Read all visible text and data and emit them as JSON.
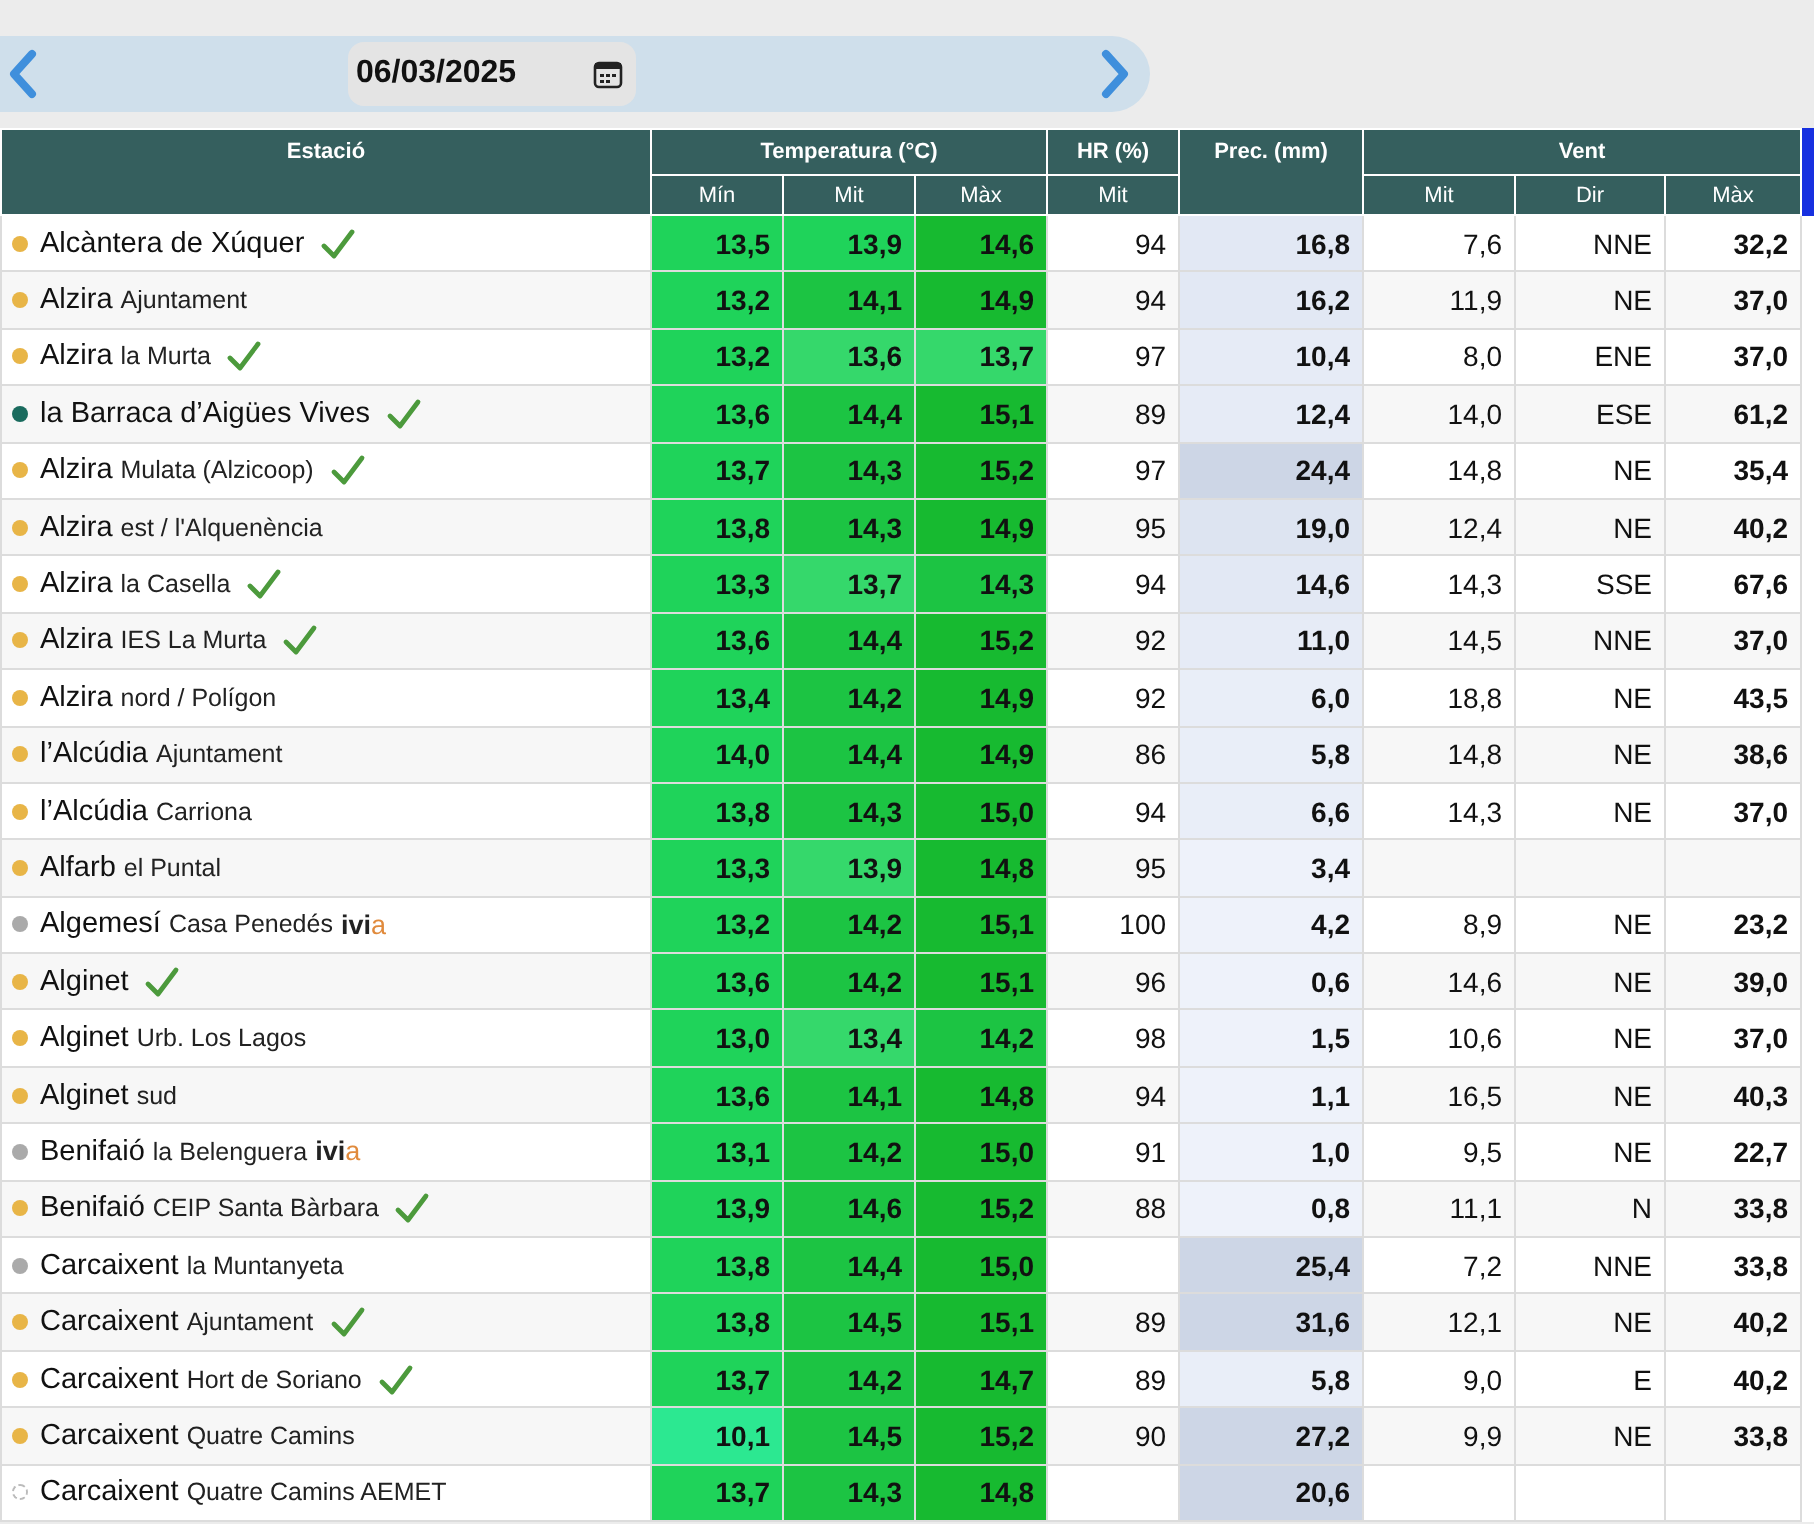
{
  "date_bar": {
    "date": "06/03/2025"
  },
  "table": {
    "groups": [
      {
        "label": "Estació"
      },
      {
        "label": "Temperatura (°C)",
        "subcolumns": [
          "Mín",
          "Mit",
          "Màx"
        ]
      },
      {
        "label": "HR (%)",
        "subcolumns": [
          "Mit"
        ]
      },
      {
        "label": "Prec. (mm)"
      },
      {
        "label": "Vent",
        "subcolumns": [
          "Mit",
          "Dir",
          "Màx"
        ]
      }
    ],
    "rows": [
      {
        "kind": "filled",
        "color": "#e8b547",
        "town": "Alcàntera de Xúquer",
        "place": null,
        "checked": true,
        "tag": null,
        "temps": [
          {
            "v": "13,5",
            "color": "#1fd35a"
          },
          {
            "v": "13,9",
            "color": "#1fd35a"
          },
          {
            "v": "14,6",
            "color": "#17ba30"
          }
        ],
        "hr": "94",
        "prec": {
          "v": "16,8",
          "color": "#e2e8f4"
        },
        "wind": "7,6",
        "dir": "NNE",
        "gust": "32,2"
      },
      {
        "kind": "filled",
        "color": "#e8b547",
        "town": "Alzira",
        "place": "Ajuntament",
        "checked": false,
        "tag": null,
        "temps": [
          {
            "v": "13,2",
            "color": "#1fd35a"
          },
          {
            "v": "14,1",
            "color": "#1cc443"
          },
          {
            "v": "14,9",
            "color": "#17ba30"
          }
        ],
        "hr": "94",
        "prec": {
          "v": "16,2",
          "color": "#e2e8f4"
        },
        "wind": "11,9",
        "dir": "NE",
        "gust": "37,0"
      },
      {
        "kind": "filled",
        "color": "#e8b547",
        "town": "Alzira",
        "place": "la Murta",
        "checked": true,
        "tag": null,
        "temps": [
          {
            "v": "13,2",
            "color": "#1fd35a"
          },
          {
            "v": "13,6",
            "color": "#35d86b"
          },
          {
            "v": "13,7",
            "color": "#35d86b"
          }
        ],
        "hr": "97",
        "prec": {
          "v": "10,4",
          "color": "#e6ebf6"
        },
        "wind": "8,0",
        "dir": "ENE",
        "gust": "37,0"
      },
      {
        "kind": "filled",
        "color": "#1a6b5e",
        "town": "la Barraca d’Aigües Vives",
        "place": null,
        "checked": true,
        "tag": null,
        "temps": [
          {
            "v": "13,6",
            "color": "#1fd35a"
          },
          {
            "v": "14,4",
            "color": "#1cc443"
          },
          {
            "v": "15,1",
            "color": "#17ba30"
          }
        ],
        "hr": "89",
        "prec": {
          "v": "12,4",
          "color": "#e6ebf6"
        },
        "wind": "14,0",
        "dir": "ESE",
        "gust": "61,2"
      },
      {
        "kind": "filled",
        "color": "#e8b547",
        "town": "Alzira",
        "place": "Mulata (Alzicoop)",
        "checked": true,
        "tag": null,
        "temps": [
          {
            "v": "13,7",
            "color": "#1fd35a"
          },
          {
            "v": "14,3",
            "color": "#1cc443"
          },
          {
            "v": "15,2",
            "color": "#17ba30"
          }
        ],
        "hr": "97",
        "prec": {
          "v": "24,4",
          "color": "#cdd6e6"
        },
        "wind": "14,8",
        "dir": "NE",
        "gust": "35,4"
      },
      {
        "kind": "filled",
        "color": "#e8b547",
        "town": "Alzira",
        "place": "est / l'Alquenència",
        "checked": false,
        "tag": null,
        "temps": [
          {
            "v": "13,8",
            "color": "#1fd35a"
          },
          {
            "v": "14,3",
            "color": "#1cc443"
          },
          {
            "v": "14,9",
            "color": "#17ba30"
          }
        ],
        "hr": "95",
        "prec": {
          "v": "19,0",
          "color": "#dde4f1"
        },
        "wind": "12,4",
        "dir": "NE",
        "gust": "40,2"
      },
      {
        "kind": "filled",
        "color": "#e8b547",
        "town": "Alzira",
        "place": "la Casella",
        "checked": true,
        "tag": null,
        "temps": [
          {
            "v": "13,3",
            "color": "#1fd35a"
          },
          {
            "v": "13,7",
            "color": "#35d86b"
          },
          {
            "v": "14,3",
            "color": "#1cc443"
          }
        ],
        "hr": "94",
        "prec": {
          "v": "14,6",
          "color": "#e2e8f4"
        },
        "wind": "14,3",
        "dir": "SSE",
        "gust": "67,6"
      },
      {
        "kind": "filled",
        "color": "#e8b547",
        "town": "Alzira",
        "place": "IES La Murta",
        "checked": true,
        "tag": null,
        "temps": [
          {
            "v": "13,6",
            "color": "#1fd35a"
          },
          {
            "v": "14,4",
            "color": "#1cc443"
          },
          {
            "v": "15,2",
            "color": "#17ba30"
          }
        ],
        "hr": "92",
        "prec": {
          "v": "11,0",
          "color": "#e6ebf6"
        },
        "wind": "14,5",
        "dir": "NNE",
        "gust": "37,0"
      },
      {
        "kind": "filled",
        "color": "#e8b547",
        "town": "Alzira",
        "place": "nord / Polígon",
        "checked": false,
        "tag": null,
        "temps": [
          {
            "v": "13,4",
            "color": "#1fd35a"
          },
          {
            "v": "14,2",
            "color": "#1cc443"
          },
          {
            "v": "14,9",
            "color": "#17ba30"
          }
        ],
        "hr": "92",
        "prec": {
          "v": "6,0",
          "color": "#e9eef8"
        },
        "wind": "18,8",
        "dir": "NE",
        "gust": "43,5"
      },
      {
        "kind": "filled",
        "color": "#e8b547",
        "town": "l’Alcúdia",
        "place": "Ajuntament",
        "checked": false,
        "tag": null,
        "temps": [
          {
            "v": "14,0",
            "color": "#1fd35a"
          },
          {
            "v": "14,4",
            "color": "#1cc443"
          },
          {
            "v": "14,9",
            "color": "#17ba30"
          }
        ],
        "hr": "86",
        "prec": {
          "v": "5,8",
          "color": "#e9eef8"
        },
        "wind": "14,8",
        "dir": "NE",
        "gust": "38,6"
      },
      {
        "kind": "filled",
        "color": "#e8b547",
        "town": "l’Alcúdia",
        "place": "Carriona",
        "checked": false,
        "tag": null,
        "temps": [
          {
            "v": "13,8",
            "color": "#1fd35a"
          },
          {
            "v": "14,3",
            "color": "#1cc443"
          },
          {
            "v": "15,0",
            "color": "#17ba30"
          }
        ],
        "hr": "94",
        "prec": {
          "v": "6,6",
          "color": "#e9eef8"
        },
        "wind": "14,3",
        "dir": "NE",
        "gust": "37,0"
      },
      {
        "kind": "filled",
        "color": "#e8b547",
        "town": "Alfarb",
        "place": "el Puntal",
        "checked": false,
        "tag": null,
        "temps": [
          {
            "v": "13,3",
            "color": "#1fd35a"
          },
          {
            "v": "13,9",
            "color": "#35d86b"
          },
          {
            "v": "14,8",
            "color": "#17ba30"
          }
        ],
        "hr": "95",
        "prec": {
          "v": "3,4",
          "color": "#eef2fa"
        },
        "wind": null,
        "dir": null,
        "gust": null
      },
      {
        "kind": "filled",
        "color": "#aaaaaa",
        "town": "Algemesí",
        "place": "Casa Penedés",
        "checked": false,
        "tag": {
          "main": "ivi",
          "accent": "a"
        },
        "temps": [
          {
            "v": "13,2",
            "color": "#1fd35a"
          },
          {
            "v": "14,2",
            "color": "#1cc443"
          },
          {
            "v": "15,1",
            "color": "#17ba30"
          }
        ],
        "hr": "100",
        "prec": {
          "v": "4,2",
          "color": "#eef2fa"
        },
        "wind": "8,9",
        "dir": "NE",
        "gust": "23,2"
      },
      {
        "kind": "filled",
        "color": "#e8b547",
        "town": "Alginet",
        "place": null,
        "checked": true,
        "tag": null,
        "temps": [
          {
            "v": "13,6",
            "color": "#1fd35a"
          },
          {
            "v": "14,2",
            "color": "#1cc443"
          },
          {
            "v": "15,1",
            "color": "#17ba30"
          }
        ],
        "hr": "96",
        "prec": {
          "v": "0,6",
          "color": "#eef2fa"
        },
        "wind": "14,6",
        "dir": "NE",
        "gust": "39,0"
      },
      {
        "kind": "filled",
        "color": "#e8b547",
        "town": "Alginet",
        "place": "Urb. Los Lagos",
        "checked": false,
        "tag": null,
        "temps": [
          {
            "v": "13,0",
            "color": "#1fd35a"
          },
          {
            "v": "13,4",
            "color": "#35d86b"
          },
          {
            "v": "14,2",
            "color": "#1cc443"
          }
        ],
        "hr": "98",
        "prec": {
          "v": "1,5",
          "color": "#eef2fa"
        },
        "wind": "10,6",
        "dir": "NE",
        "gust": "37,0"
      },
      {
        "kind": "filled",
        "color": "#e8b547",
        "town": "Alginet",
        "place": "sud",
        "checked": false,
        "tag": null,
        "temps": [
          {
            "v": "13,6",
            "color": "#1fd35a"
          },
          {
            "v": "14,1",
            "color": "#1cc443"
          },
          {
            "v": "14,8",
            "color": "#17ba30"
          }
        ],
        "hr": "94",
        "prec": {
          "v": "1,1",
          "color": "#eef2fa"
        },
        "wind": "16,5",
        "dir": "NE",
        "gust": "40,3"
      },
      {
        "kind": "filled",
        "color": "#aaaaaa",
        "town": "Benifaió",
        "place": "la Belenguera",
        "checked": false,
        "tag": {
          "main": "ivi",
          "accent": "a"
        },
        "temps": [
          {
            "v": "13,1",
            "color": "#1fd35a"
          },
          {
            "v": "14,2",
            "color": "#1cc443"
          },
          {
            "v": "15,0",
            "color": "#17ba30"
          }
        ],
        "hr": "91",
        "prec": {
          "v": "1,0",
          "color": "#eef2fa"
        },
        "wind": "9,5",
        "dir": "NE",
        "gust": "22,7"
      },
      {
        "kind": "filled",
        "color": "#e8b547",
        "town": "Benifaió",
        "place": "CEIP Santa Bàrbara",
        "checked": true,
        "tag": null,
        "temps": [
          {
            "v": "13,9",
            "color": "#1fd35a"
          },
          {
            "v": "14,6",
            "color": "#1cc443"
          },
          {
            "v": "15,2",
            "color": "#17ba30"
          }
        ],
        "hr": "88",
        "prec": {
          "v": "0,8",
          "color": "#eef2fa"
        },
        "wind": "11,1",
        "dir": "N",
        "gust": "33,8"
      },
      {
        "kind": "filled",
        "color": "#aaaaaa",
        "town": "Carcaixent",
        "place": "la Muntanyeta",
        "checked": false,
        "tag": null,
        "temps": [
          {
            "v": "13,8",
            "color": "#1fd35a"
          },
          {
            "v": "14,4",
            "color": "#1cc443"
          },
          {
            "v": "15,0",
            "color": "#17ba30"
          }
        ],
        "hr": null,
        "prec": {
          "v": "25,4",
          "color": "#cdd6e6"
        },
        "wind": "7,2",
        "dir": "NNE",
        "gust": "33,8"
      },
      {
        "kind": "filled",
        "color": "#e8b547",
        "town": "Carcaixent",
        "place": "Ajuntament",
        "checked": true,
        "tag": null,
        "temps": [
          {
            "v": "13,8",
            "color": "#1fd35a"
          },
          {
            "v": "14,5",
            "color": "#1cc443"
          },
          {
            "v": "15,1",
            "color": "#17ba30"
          }
        ],
        "hr": "89",
        "prec": {
          "v": "31,6",
          "color": "#cdd6e6"
        },
        "wind": "12,1",
        "dir": "NE",
        "gust": "40,2"
      },
      {
        "kind": "filled",
        "color": "#e8b547",
        "town": "Carcaixent",
        "place": "Hort de Soriano",
        "checked": true,
        "tag": null,
        "temps": [
          {
            "v": "13,7",
            "color": "#1fd35a"
          },
          {
            "v": "14,2",
            "color": "#1cc443"
          },
          {
            "v": "14,7",
            "color": "#17ba30"
          }
        ],
        "hr": "89",
        "prec": {
          "v": "5,8",
          "color": "#e9eef8"
        },
        "wind": "9,0",
        "dir": "E",
        "gust": "40,2"
      },
      {
        "kind": "filled",
        "color": "#e8b547",
        "town": "Carcaixent",
        "place": "Quatre Camins",
        "checked": false,
        "tag": null,
        "temps": [
          {
            "v": "10,1",
            "color": "#2ce891"
          },
          {
            "v": "14,5",
            "color": "#1cc443"
          },
          {
            "v": "15,2",
            "color": "#17ba30"
          }
        ],
        "hr": "90",
        "prec": {
          "v": "27,2",
          "color": "#cdd6e6"
        },
        "wind": "9,9",
        "dir": "NE",
        "gust": "33,8"
      },
      {
        "kind": "outline",
        "color": "#bbbbbb",
        "town": "Carcaixent",
        "place": "Quatre Camins AEMET",
        "checked": false,
        "tag": null,
        "temps": [
          {
            "v": "13,7",
            "color": "#1fd35a"
          },
          {
            "v": "14,3",
            "color": "#1cc443"
          },
          {
            "v": "14,8",
            "color": "#17ba30"
          }
        ],
        "hr": null,
        "prec": {
          "v": "20,6",
          "color": "#cdd6e6"
        },
        "wind": null,
        "dir": null,
        "gust": null
      }
    ]
  }
}
